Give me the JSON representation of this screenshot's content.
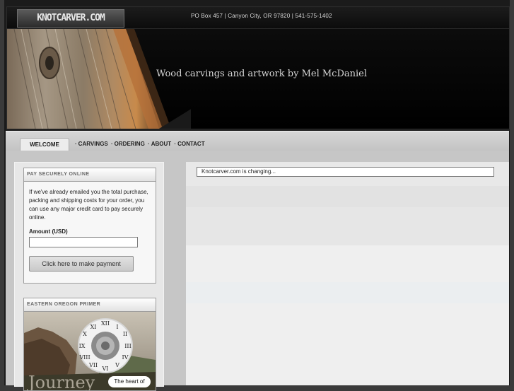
{
  "header": {
    "logo_text": "KNOTCARVER.COM",
    "contact": "PO Box 457 | Canyon City, OR 97820 | 541-575-1402",
    "tagline": "Wood carvings and artwork by Mel McDaniel"
  },
  "nav": {
    "active_tab": "WELCOME",
    "links": [
      "CARVINGS",
      "ORDERING",
      "ABOUT",
      "CONTACT"
    ],
    "separator": "·"
  },
  "sidebar": {
    "pay": {
      "title": "PAY SECURELY ONLINE",
      "text": "If we've already emailed you the total purchase, packing and shipping costs for your order, you can use any major credit card to pay securely online.",
      "amount_label": "Amount (USD)",
      "amount_value": "",
      "button_label": "Click here to make payment"
    },
    "primer": {
      "title": "EASTERN OREGON PRIMER",
      "caption": "The heart of"
    }
  },
  "main": {
    "notice": "Knotcarver.com is changing..."
  },
  "colors": {
    "background": "#1b1b1b",
    "nav": "#cfcfcf",
    "panel": "#f7f7f7"
  }
}
